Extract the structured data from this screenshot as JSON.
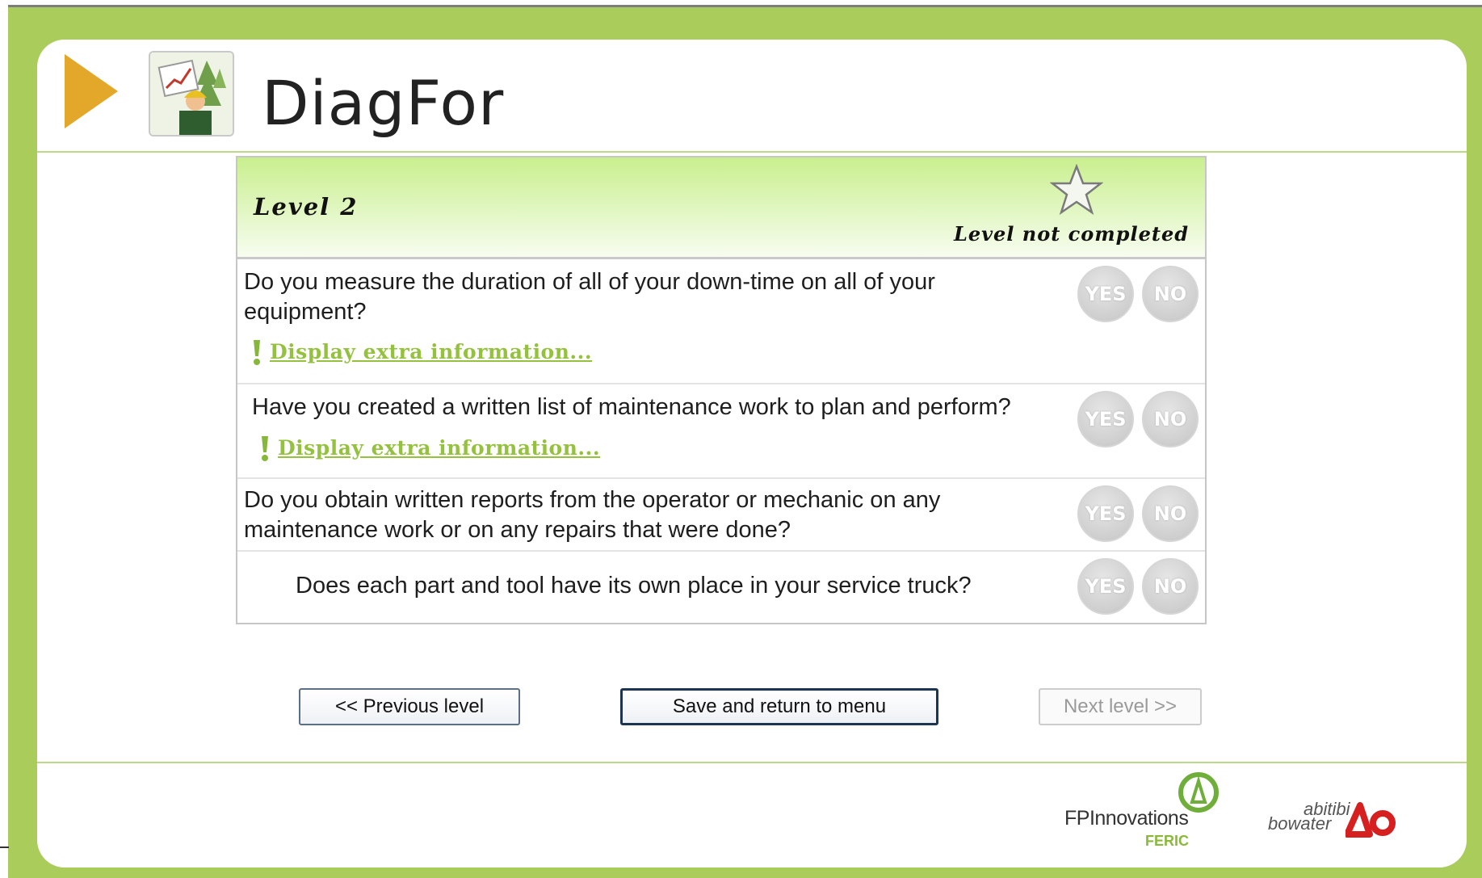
{
  "app": {
    "title": "DiagFor"
  },
  "level": {
    "title": "Level 2",
    "status": "Level not completed"
  },
  "questions": [
    {
      "text": "Do you measure the duration of all of your down-time on all of your equipment?",
      "info": "Display extra information..."
    },
    {
      "text": "Have you created a written list of maintenance work to plan and perform?",
      "info": "Display extra information..."
    },
    {
      "text": "Do you obtain written reports from the operator or mechanic on any maintenance work or on any repairs that were done?"
    },
    {
      "text": "Does each part and tool have its own place in your service truck?"
    }
  ],
  "answers": {
    "yes": "YES",
    "no": "NO"
  },
  "nav": {
    "previous": "<< Previous level",
    "save": "Save and return to menu",
    "next": "Next level >>"
  },
  "footer": {
    "fp_name": "FPInnovations",
    "fp_sub": "FERIC",
    "ab_line1": "abitibi",
    "ab_line2": "bowater"
  },
  "colors": {
    "frame": "#a9cc5a",
    "accent": "#94c13e",
    "play": "#e3a72a"
  }
}
